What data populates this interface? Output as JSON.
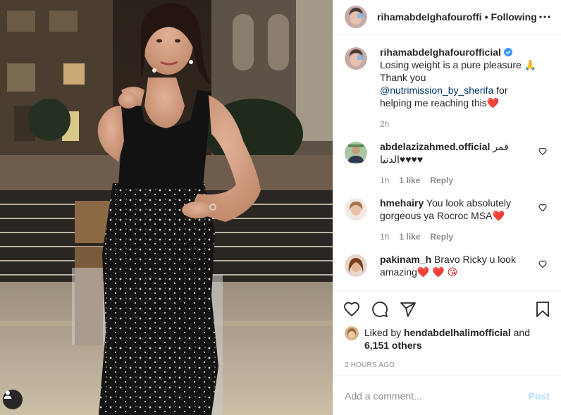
{
  "header": {
    "username": "rihamabdelghafouroffi",
    "separator": "•",
    "follow_status": "Following"
  },
  "caption": {
    "username": "rihamabdelghafourofficial",
    "text_before": " Losing weight is a pure pleasure 🙏 Thank you ",
    "mention": "@nutrimission_by_sherifa",
    "text_after": " for helping me reaching this",
    "emoji": "❤️",
    "time": "2h"
  },
  "comments": [
    {
      "username": "abdelazizahmed.official",
      "text": " قمر الدنيا♥♥♥♥",
      "time": "1h",
      "likes": "1 like",
      "reply": "Reply"
    },
    {
      "username": "hmehairy",
      "text": " You look absolutely gorgeous ya Rocroc MSA",
      "emoji": "❤️",
      "time": "1h",
      "likes": "1 like",
      "reply": "Reply"
    },
    {
      "username": "pakinam_h",
      "text": " Bravo Ricky u look amazing",
      "emoji": "❤️ ❤️ 😘",
      "time": "",
      "likes": "",
      "reply": ""
    }
  ],
  "likes": {
    "prefix": "Liked by ",
    "user": "hendabdelhalimofficial",
    "middle": " and",
    "others": "6,151 others"
  },
  "timestamp": "2 HOURS AGO",
  "add_comment": {
    "placeholder": "Add a comment...",
    "post_label": "Post"
  },
  "icons": {
    "like": "heart-outline-icon",
    "comment": "comment-bubble-icon",
    "share": "paper-plane-icon",
    "save": "bookmark-icon",
    "more": "ellipsis-icon",
    "tag": "person-tag-icon"
  },
  "colors": {
    "link": "#00376b",
    "meta": "#8e8e8e",
    "post_disabled": "#b2dffc",
    "verified": "#3897f0",
    "heart": "#ed1c24"
  }
}
